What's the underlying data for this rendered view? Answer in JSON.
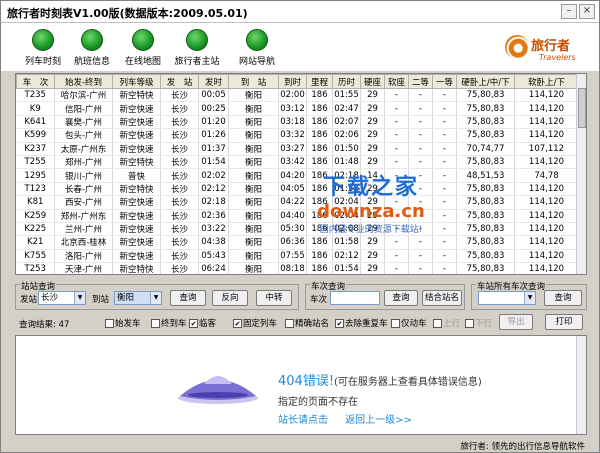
{
  "window": {
    "title": "旅行者时刻表V1.00版(数据版本:2009.05.01)"
  },
  "toolbar": {
    "buttons": [
      {
        "label": "列车时刻"
      },
      {
        "label": "航班信息"
      },
      {
        "label": "在线地图"
      },
      {
        "label": "旅行者主站"
      },
      {
        "label": "网站导航"
      }
    ],
    "logo": {
      "cn": "旅行者",
      "en": "Travelers"
    }
  },
  "grid": {
    "columns": [
      "车　次",
      "始发-终到",
      "列车等级",
      "发　站",
      "发时",
      "到　站",
      "到时",
      "里程",
      "历时",
      "硬座",
      "软座",
      "二等",
      "一等",
      "硬卧上/中/下",
      "软卧上/下"
    ],
    "rows": [
      [
        "T235",
        "哈尔滨-广州",
        "新空特快",
        "长沙",
        "00:05",
        "衡阳",
        "02:00",
        "186",
        "01:55",
        "29",
        "-",
        "-",
        "-",
        "75,80,83",
        "114,120"
      ],
      [
        "K9",
        "信阳-广州",
        "新空快速",
        "长沙",
        "00:25",
        "衡阳",
        "03:12",
        "186",
        "02:47",
        "29",
        "-",
        "-",
        "-",
        "75,80,83",
        "114,120"
      ],
      [
        "K641",
        "襄樊-广州",
        "新空快速",
        "长沙",
        "01:20",
        "衡阳",
        "03:18",
        "186",
        "02:07",
        "29",
        "-",
        "-",
        "-",
        "75,80,83",
        "114,120"
      ],
      [
        "K599",
        "包头-广州",
        "新空快速",
        "长沙",
        "01:26",
        "衡阳",
        "03:32",
        "186",
        "02:06",
        "29",
        "-",
        "-",
        "-",
        "75,80,83",
        "114,120"
      ],
      [
        "K237",
        "太原-广州东",
        "新空快速",
        "长沙",
        "01:37",
        "衡阳",
        "03:27",
        "186",
        "01:50",
        "29",
        "-",
        "-",
        "-",
        "70,74,77",
        "107,112"
      ],
      [
        "T255",
        "郑州-广州",
        "新空特快",
        "长沙",
        "01:54",
        "衡阳",
        "03:42",
        "186",
        "01:48",
        "29",
        "-",
        "-",
        "-",
        "75,80,83",
        "114,120"
      ],
      [
        "1295",
        "银川-广州",
        "普快",
        "长沙",
        "02:02",
        "衡阳",
        "04:20",
        "186",
        "02:18",
        "14",
        "-",
        "-",
        "-",
        "48,51,53",
        "74,78"
      ],
      [
        "T123",
        "长春-广州",
        "新空特快",
        "长沙",
        "02:12",
        "衡阳",
        "04:05",
        "186",
        "01:53",
        "29",
        "-",
        "-",
        "-",
        "75,80,83",
        "114,120"
      ],
      [
        "K81",
        "西安-广州",
        "新空快速",
        "长沙",
        "02:18",
        "衡阳",
        "04:22",
        "186",
        "02:04",
        "29",
        "-",
        "-",
        "-",
        "75,80,83",
        "114,120"
      ],
      [
        "K259",
        "郑州-广州东",
        "新空快速",
        "长沙",
        "02:36",
        "衡阳",
        "04:40",
        "186",
        "02:04",
        "29",
        "-",
        "-",
        "-",
        "75,80,83",
        "114,120"
      ],
      [
        "K225",
        "兰州-广州",
        "新空快速",
        "长沙",
        "03:22",
        "衡阳",
        "05:30",
        "186",
        "02:08",
        "29",
        "-",
        "-",
        "-",
        "75,80,83",
        "114,120"
      ],
      [
        "K21",
        "北京西-桂林",
        "新空快速",
        "长沙",
        "04:38",
        "衡阳",
        "06:36",
        "186",
        "01:58",
        "29",
        "-",
        "-",
        "-",
        "75,80,83",
        "114,120"
      ],
      [
        "K755",
        "洛阳-广州",
        "新空快速",
        "长沙",
        "05:43",
        "衡阳",
        "07:55",
        "186",
        "02:12",
        "29",
        "-",
        "-",
        "-",
        "75,80,83",
        "114,120"
      ],
      [
        "T253",
        "天津-广州",
        "新空特快",
        "长沙",
        "06:24",
        "衡阳",
        "08:18",
        "186",
        "01:54",
        "29",
        "-",
        "-",
        "-",
        "75,80,83",
        "114,120"
      ]
    ]
  },
  "watermark": {
    "line1": "下载之家",
    "line2": "downza.cn",
    "line3": "国内最专业的资源下载站!"
  },
  "station_query": {
    "legend": "站站查询",
    "from_label": "发站",
    "from_value": "长沙",
    "to_label": "到站",
    "to_value": "衡阳",
    "query": "查询",
    "reverse": "反向",
    "transfer": "中转"
  },
  "train_query": {
    "legend": "车次查询",
    "label": "车次",
    "value": "",
    "query": "查询",
    "combine": "结合站名"
  },
  "station_all": {
    "legend": "车站所有车次查询",
    "value": "",
    "query": "查询"
  },
  "result": {
    "label": "查询结果: 47"
  },
  "filters": [
    {
      "label": "始发车",
      "checked": false
    },
    {
      "label": "终到车",
      "checked": false
    },
    {
      "label": "临客",
      "checked": true
    },
    {
      "label": "固定列车",
      "checked": true
    },
    {
      "label": "精确站名",
      "checked": false
    },
    {
      "label": "去除重复车",
      "checked": true
    },
    {
      "label": "仅动车",
      "checked": false
    },
    {
      "label": "上行",
      "checked": false
    },
    {
      "label": "下行",
      "checked": false
    }
  ],
  "actions": {
    "export": "导出",
    "print": "打印"
  },
  "web": {
    "title": "404错误!",
    "title_note": "(可在服务器上查看具体错误信息)",
    "line2": "指定的页面不存在",
    "link1": "站长请点击",
    "link2": "返回上一级>>"
  },
  "status": {
    "text": "旅行者: 领先的出行信息导航软件"
  },
  "colors": {
    "link": "#1f8bd6",
    "watermark_blue": "#1e6bd6",
    "watermark_orange": "#e05a10"
  }
}
